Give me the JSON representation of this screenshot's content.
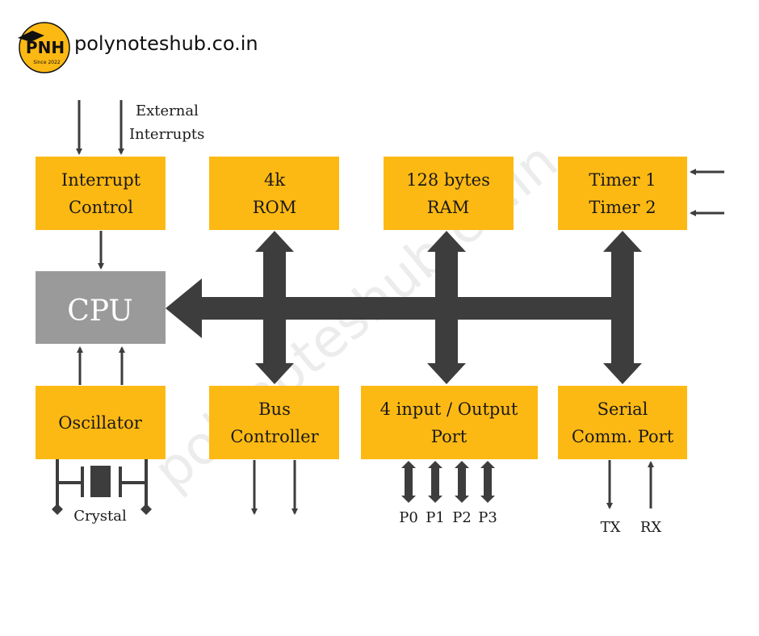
{
  "header": {
    "logo_text": "PNH",
    "logo_since": "Since 2022",
    "site": "polynoteshub.co.in"
  },
  "watermark": "polynoteshub.co.in",
  "colors": {
    "block": "#FDB913",
    "cpu": "#9A9A9A",
    "bus": "#3D3D3D",
    "cpu_text": "#FFFFFF"
  },
  "blocks": {
    "interrupt": [
      "Interrupt",
      "Control"
    ],
    "rom": [
      "4k",
      "ROM"
    ],
    "ram": [
      "128 bytes",
      "RAM"
    ],
    "timer": [
      "Timer 1",
      "Timer 2"
    ],
    "cpu": "CPU",
    "oscillator": "Oscillator",
    "bus_controller": [
      "Bus",
      "Controller"
    ],
    "io_port": [
      "4 input / Output",
      "Port"
    ],
    "serial": [
      "Serial",
      "Comm. Port"
    ]
  },
  "labels": {
    "external_interrupts": [
      "External",
      "Interrupts"
    ],
    "crystal": "Crystal",
    "ports": [
      "P0",
      "P1",
      "P2",
      "P3"
    ],
    "tx": "TX",
    "rx": "RX"
  }
}
